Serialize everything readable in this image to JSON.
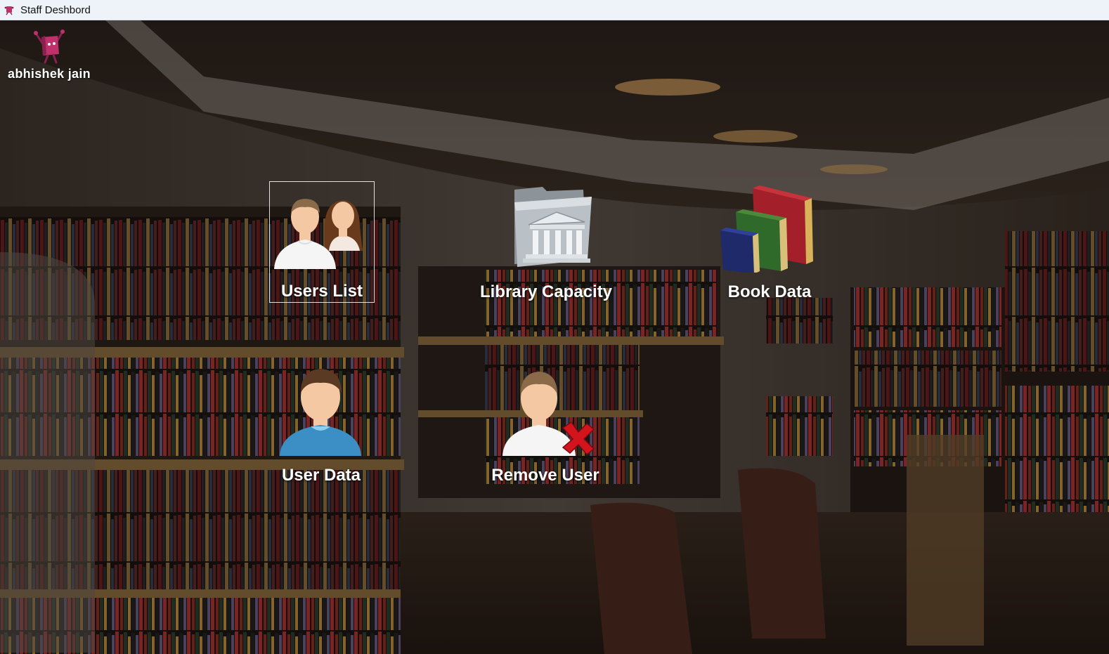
{
  "window": {
    "title": "Staff Deshbord"
  },
  "user": {
    "name": "abhishek jain"
  },
  "tiles": [
    {
      "label": "Users List",
      "icon": "users-group-icon",
      "selected": true
    },
    {
      "label": "Library Capacity",
      "icon": "library-folder-icon",
      "selected": false
    },
    {
      "label": "Book Data",
      "icon": "books-icon",
      "selected": false
    },
    {
      "label": "User Data",
      "icon": "user-icon",
      "selected": false
    },
    {
      "label": "Remove User",
      "icon": "remove-user-icon",
      "selected": false
    }
  ]
}
